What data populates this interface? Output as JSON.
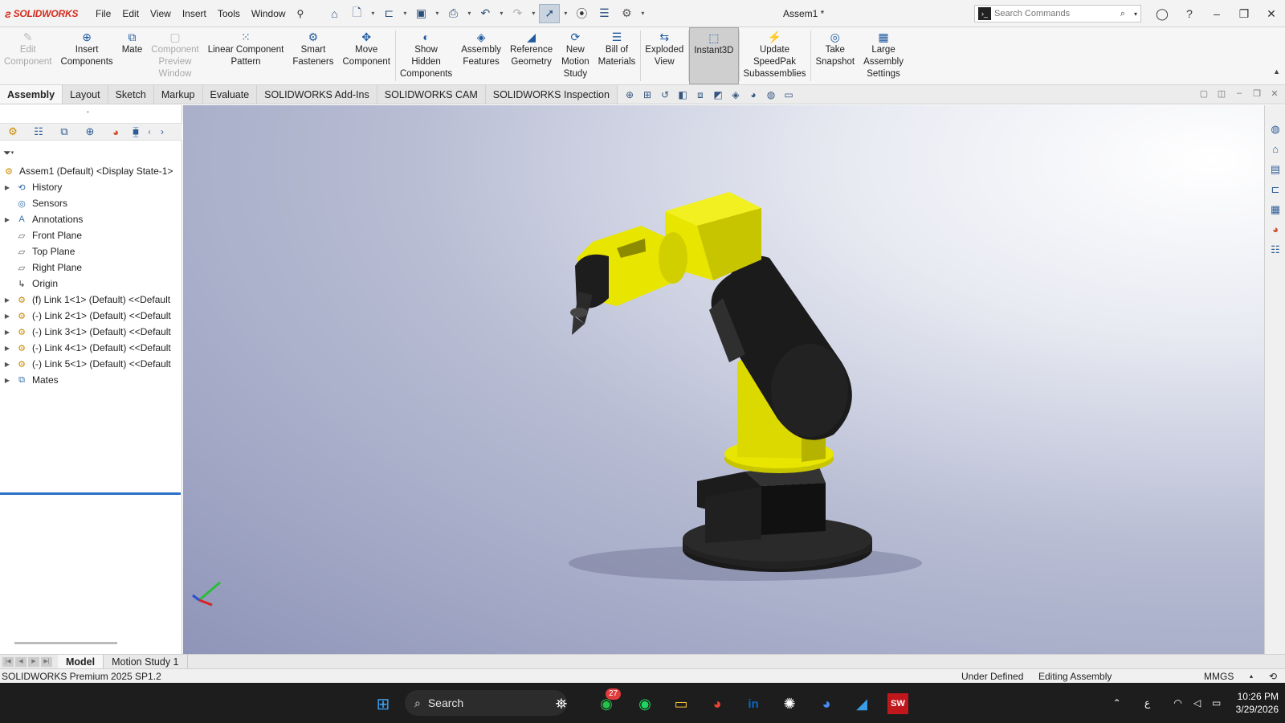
{
  "app": {
    "logo_text": "SOLIDWORKS",
    "document_title": "Assem1 *"
  },
  "menu": [
    "File",
    "Edit",
    "View",
    "Insert",
    "Tools",
    "Window"
  ],
  "search_commands": {
    "placeholder": "Search Commands"
  },
  "command_manager": [
    {
      "label": "Edit\nComponent",
      "icon": "edit-component-icon",
      "enabled": false
    },
    {
      "label": "Insert\nComponents",
      "icon": "insert-components-icon",
      "enabled": true
    },
    {
      "label": "Mate",
      "icon": "mate-icon",
      "enabled": true
    },
    {
      "label": "Component\nPreview\nWindow",
      "icon": "preview-window-icon",
      "enabled": false
    },
    {
      "label": "Linear Component\nPattern",
      "icon": "linear-pattern-icon",
      "enabled": true
    },
    {
      "label": "Smart\nFasteners",
      "icon": "smart-fasteners-icon",
      "enabled": true
    },
    {
      "label": "Move\nComponent",
      "icon": "move-component-icon",
      "enabled": true
    },
    {
      "label": "Show\nHidden\nComponents",
      "icon": "show-hidden-icon",
      "enabled": true
    },
    {
      "label": "Assembly\nFeatures",
      "icon": "assembly-features-icon",
      "enabled": true
    },
    {
      "label": "Reference\nGeometry",
      "icon": "reference-geometry-icon",
      "enabled": true
    },
    {
      "label": "New\nMotion\nStudy",
      "icon": "motion-study-icon",
      "enabled": true
    },
    {
      "label": "Bill of\nMaterials",
      "icon": "bom-icon",
      "enabled": true
    },
    {
      "label": "Exploded\nView",
      "icon": "exploded-view-icon",
      "enabled": true
    },
    {
      "label": "Instant3D",
      "icon": "instant3d-icon",
      "enabled": true,
      "active": true
    },
    {
      "label": "Update\nSpeedPak\nSubassemblies",
      "icon": "speedpak-icon",
      "enabled": true
    },
    {
      "label": "Take\nSnapshot",
      "icon": "snapshot-icon",
      "enabled": true
    },
    {
      "label": "Large\nAssembly\nSettings",
      "icon": "large-assembly-icon",
      "enabled": true
    }
  ],
  "tabs": [
    "Assembly",
    "Layout",
    "Sketch",
    "Markup",
    "Evaluate",
    "SOLIDWORKS Add-Ins",
    "SOLIDWORKS CAM",
    "SOLIDWORKS Inspection"
  ],
  "active_tab": "Assembly",
  "feature_tree": {
    "root": "Assem1 (Default) <Display State-1>",
    "items": [
      {
        "label": "History",
        "expandable": true,
        "icon": "history-icon"
      },
      {
        "label": "Sensors",
        "expandable": false,
        "icon": "sensors-icon"
      },
      {
        "label": "Annotations",
        "expandable": true,
        "icon": "annotations-icon"
      },
      {
        "label": "Front Plane",
        "expandable": false,
        "icon": "plane-icon"
      },
      {
        "label": "Top Plane",
        "expandable": false,
        "icon": "plane-icon"
      },
      {
        "label": "Right Plane",
        "expandable": false,
        "icon": "plane-icon"
      },
      {
        "label": "Origin",
        "expandable": false,
        "icon": "origin-icon"
      },
      {
        "label": "(f) Link 1<1> (Default) <<Default",
        "expandable": true,
        "icon": "part-icon"
      },
      {
        "label": "(-) Link 2<1> (Default) <<Default",
        "expandable": true,
        "icon": "part-icon"
      },
      {
        "label": "(-) Link 3<1> (Default) <<Default",
        "expandable": true,
        "icon": "part-icon"
      },
      {
        "label": "(-) Link 4<1> (Default) <<Default",
        "expandable": true,
        "icon": "part-icon"
      },
      {
        "label": "(-) Link 5<1> (Default) <<Default",
        "expandable": true,
        "icon": "part-icon"
      },
      {
        "label": "Mates",
        "expandable": true,
        "icon": "mates-icon"
      }
    ]
  },
  "bottom_tabs": [
    "Model",
    "Motion Study 1"
  ],
  "status": {
    "version": "SOLIDWORKS Premium 2025 SP1.2",
    "state": "Under Defined",
    "mode": "Editing Assembly",
    "units": "MMGS"
  },
  "taskbar": {
    "search_label": "Search",
    "badge": "27",
    "time": "10:26 PM",
    "date": "3/29/2026"
  },
  "colors": {
    "robot_yellow": "#e8e600",
    "robot_black": "#1e1e1e",
    "accent_blue": "#2a71c8",
    "brand_red": "#d52b1e"
  }
}
